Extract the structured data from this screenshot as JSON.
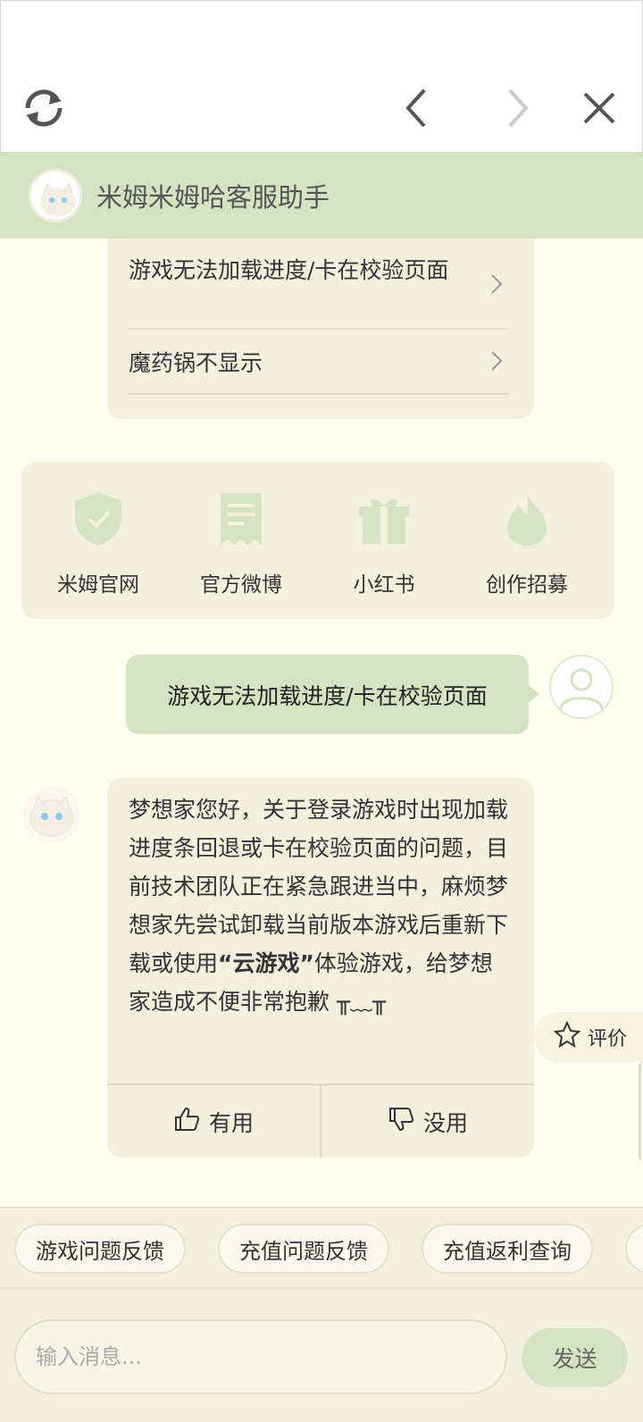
{
  "topbar": {
    "refresh_icon": "refresh-icon",
    "back_icon": "chevron-left-icon",
    "forward_icon": "chevron-right-icon",
    "close_icon": "close-icon"
  },
  "header": {
    "title": "米姆米姆哈客服助手",
    "bg_color": "#d6e3c3"
  },
  "questions": [
    {
      "label": "游戏无法加载进度/卡在校验页面"
    },
    {
      "label": "魔药锅不显示"
    }
  ],
  "links": [
    {
      "label": "米姆官网",
      "icon": "shield-check-icon"
    },
    {
      "label": "官方微博",
      "icon": "document-icon"
    },
    {
      "label": "小红书",
      "icon": "gift-icon"
    },
    {
      "label": "创作招募",
      "icon": "flame-icon"
    }
  ],
  "chat": {
    "user_message": "游戏无法加载进度/卡在校验页面",
    "bot_reply_part1": "梦想家您好，关于登录游戏时出现加载进度条回退或卡在校验页面的问题，目前技术团队正在紧急跟进当中，麻烦梦想家先尝试卸载当前版本游戏后重新下载或使用",
    "bot_reply_bold": "“云游戏”",
    "bot_reply_part2": "体验游戏，给梦想家造成不便非常抱歉 ╥﹏╥",
    "useful_label": "有用",
    "useless_label": "没用"
  },
  "rate_label": "评价",
  "chips": [
    "游戏问题反馈",
    "充值问题反馈",
    "充值返利查询"
  ],
  "input": {
    "placeholder": "输入消息...",
    "send_label": "发送"
  }
}
